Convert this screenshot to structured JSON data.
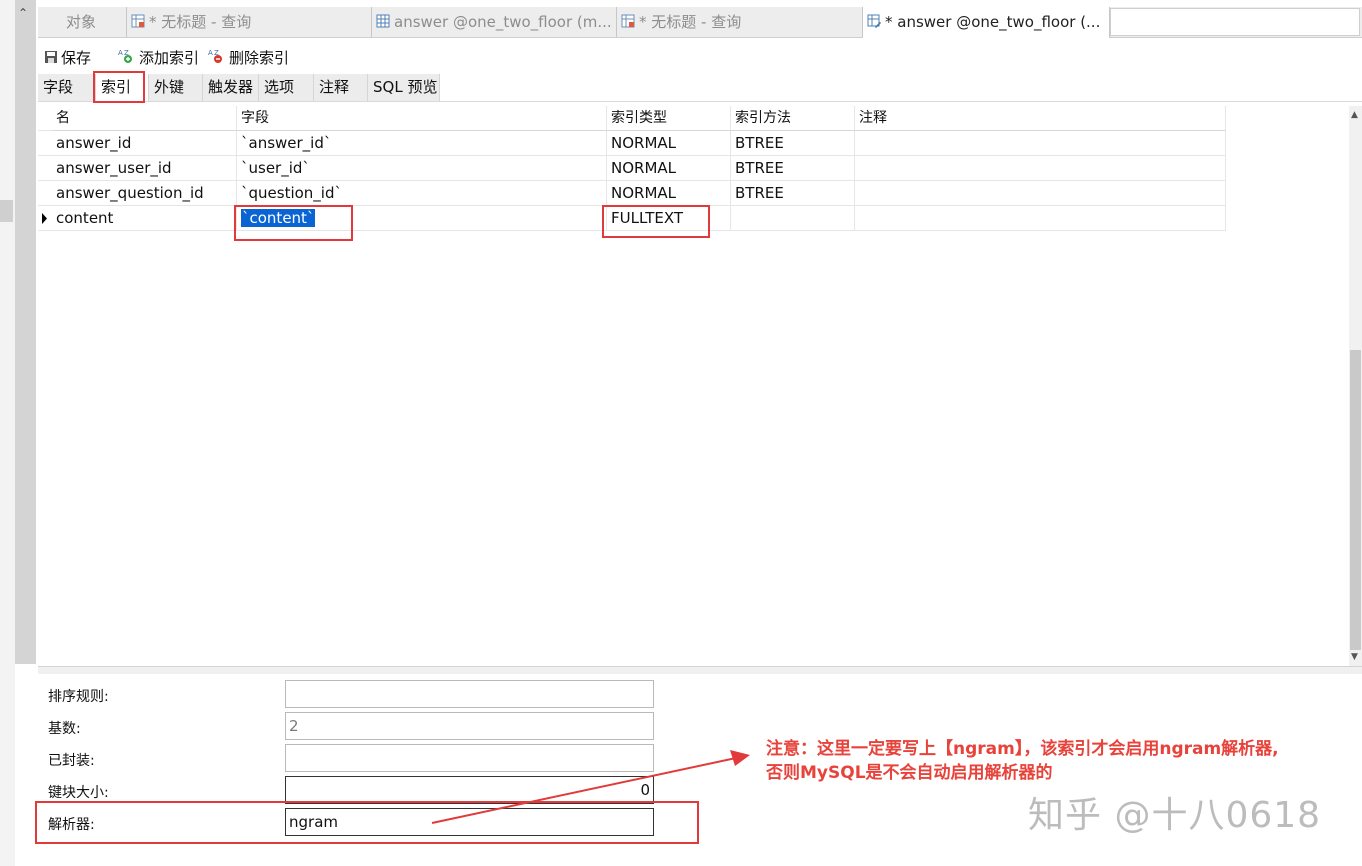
{
  "tabs": [
    {
      "label": "对象",
      "icon": "none"
    },
    {
      "label": "* 无标题 - 查询",
      "icon": "query-icon"
    },
    {
      "label": "answer @one_two_floor (m...",
      "icon": "table-icon"
    },
    {
      "label": "* 无标题 - 查询",
      "icon": "query-icon"
    },
    {
      "label": "* answer @one_two_floor (...",
      "icon": "table-design-icon"
    }
  ],
  "toolbar": {
    "save": "保存",
    "add_index": "添加索引",
    "delete_index": "删除索引"
  },
  "subtabs": [
    "字段",
    "索引",
    "外键",
    "触发器",
    "选项",
    "注释",
    "SQL 预览"
  ],
  "active_subtab": "索引",
  "grid": {
    "headers": [
      "名",
      "字段",
      "索引类型",
      "索引方法",
      "注释"
    ],
    "rows": [
      {
        "name": "answer_id",
        "field": "`answer_id`",
        "type": "NORMAL",
        "method": "BTREE",
        "comment": ""
      },
      {
        "name": "answer_user_id",
        "field": "`user_id`",
        "type": "NORMAL",
        "method": "BTREE",
        "comment": ""
      },
      {
        "name": "answer_question_id",
        "field": "`question_id`",
        "type": "NORMAL",
        "method": "BTREE",
        "comment": ""
      },
      {
        "name": "content",
        "field": "`content`",
        "type": "FULLTEXT",
        "method": "",
        "comment": ""
      }
    ],
    "ellipsis": "···"
  },
  "props": {
    "collation_label": "排序规则:",
    "collation_value": "",
    "cardinality_label": "基数:",
    "cardinality_value": "2",
    "packed_label": "已封装:",
    "packed_value": "",
    "key_block_size_label": "键块大小:",
    "key_block_size_value": "0",
    "parser_label": "解析器:",
    "parser_value": "ngram"
  },
  "annotation": {
    "line1": "注意：这里一定要写上【ngram】，该索引才会启用ngram解析器,",
    "line2": "否则MySQL是不会自动启用解析器的"
  },
  "watermark": "知乎 @十八0618",
  "colors": {
    "highlight": "#e23a3a",
    "selection": "#0a64d2",
    "annotation": "#e8433b"
  }
}
